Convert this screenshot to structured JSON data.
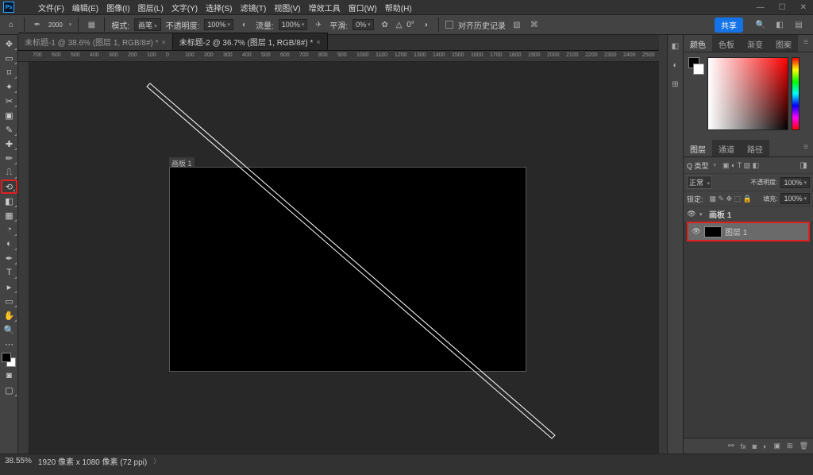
{
  "app": {
    "logo": "Ps"
  },
  "menu": {
    "file": "文件(F)",
    "edit": "编辑(E)",
    "image": "图像(I)",
    "layer": "图层(L)",
    "type": "文字(Y)",
    "select": "选择(S)",
    "filter": "滤镜(T)",
    "view": "视图(V)",
    "plugin": "增效工具",
    "window": "窗口(W)",
    "help": "帮助(H)"
  },
  "options": {
    "brush_size": "2000",
    "mode_label": "模式:",
    "mode_value": "画笔",
    "opacity_label": "不透明度:",
    "opacity_value": "100%",
    "flow_label": "流量:",
    "flow_value": "100%",
    "smooth_label": "平滑:",
    "smooth_value": "0%",
    "angle_symbol": "△",
    "angle_value": "0°",
    "clipboard_label": "对齐历史记录",
    "share": "共享"
  },
  "tabs": {
    "a": "未标题-1 @ 38.6% (图层 1, RGB/8#) *",
    "b": "未标题-2 @ 36.7% (图层 1, RGB/8#) *"
  },
  "artboard": {
    "label": "画板 1"
  },
  "status": {
    "zoom": "38.55%",
    "info": "1920 像素 x 1080 像素 (72 ppi)"
  },
  "panels": {
    "color": "颜色",
    "swatches": "色板",
    "gradients": "渐变",
    "patterns": "图案",
    "layers": "图层",
    "channels": "通道",
    "paths": "路径"
  },
  "layers": {
    "kind_label": "Q 类型",
    "blend_mode": "正常",
    "opacity_label": "不透明度:",
    "opacity_value": "100%",
    "lock_label": "锁定:",
    "fill_label": "填充:",
    "fill_value": "100%",
    "artboard_name": "画板 1",
    "layer_name": "图层 1"
  },
  "ruler_ticks": [
    "700",
    "600",
    "500",
    "400",
    "300",
    "200",
    "100",
    "0",
    "100",
    "200",
    "300",
    "400",
    "500",
    "600",
    "700",
    "800",
    "900",
    "1000",
    "1100",
    "1200",
    "1300",
    "1400",
    "1500",
    "1600",
    "1700",
    "1800",
    "1900",
    "2000",
    "2100",
    "2200",
    "2300",
    "2400",
    "2500"
  ],
  "win_controls": {
    "min": "—",
    "max": "☐",
    "close": "✕"
  }
}
